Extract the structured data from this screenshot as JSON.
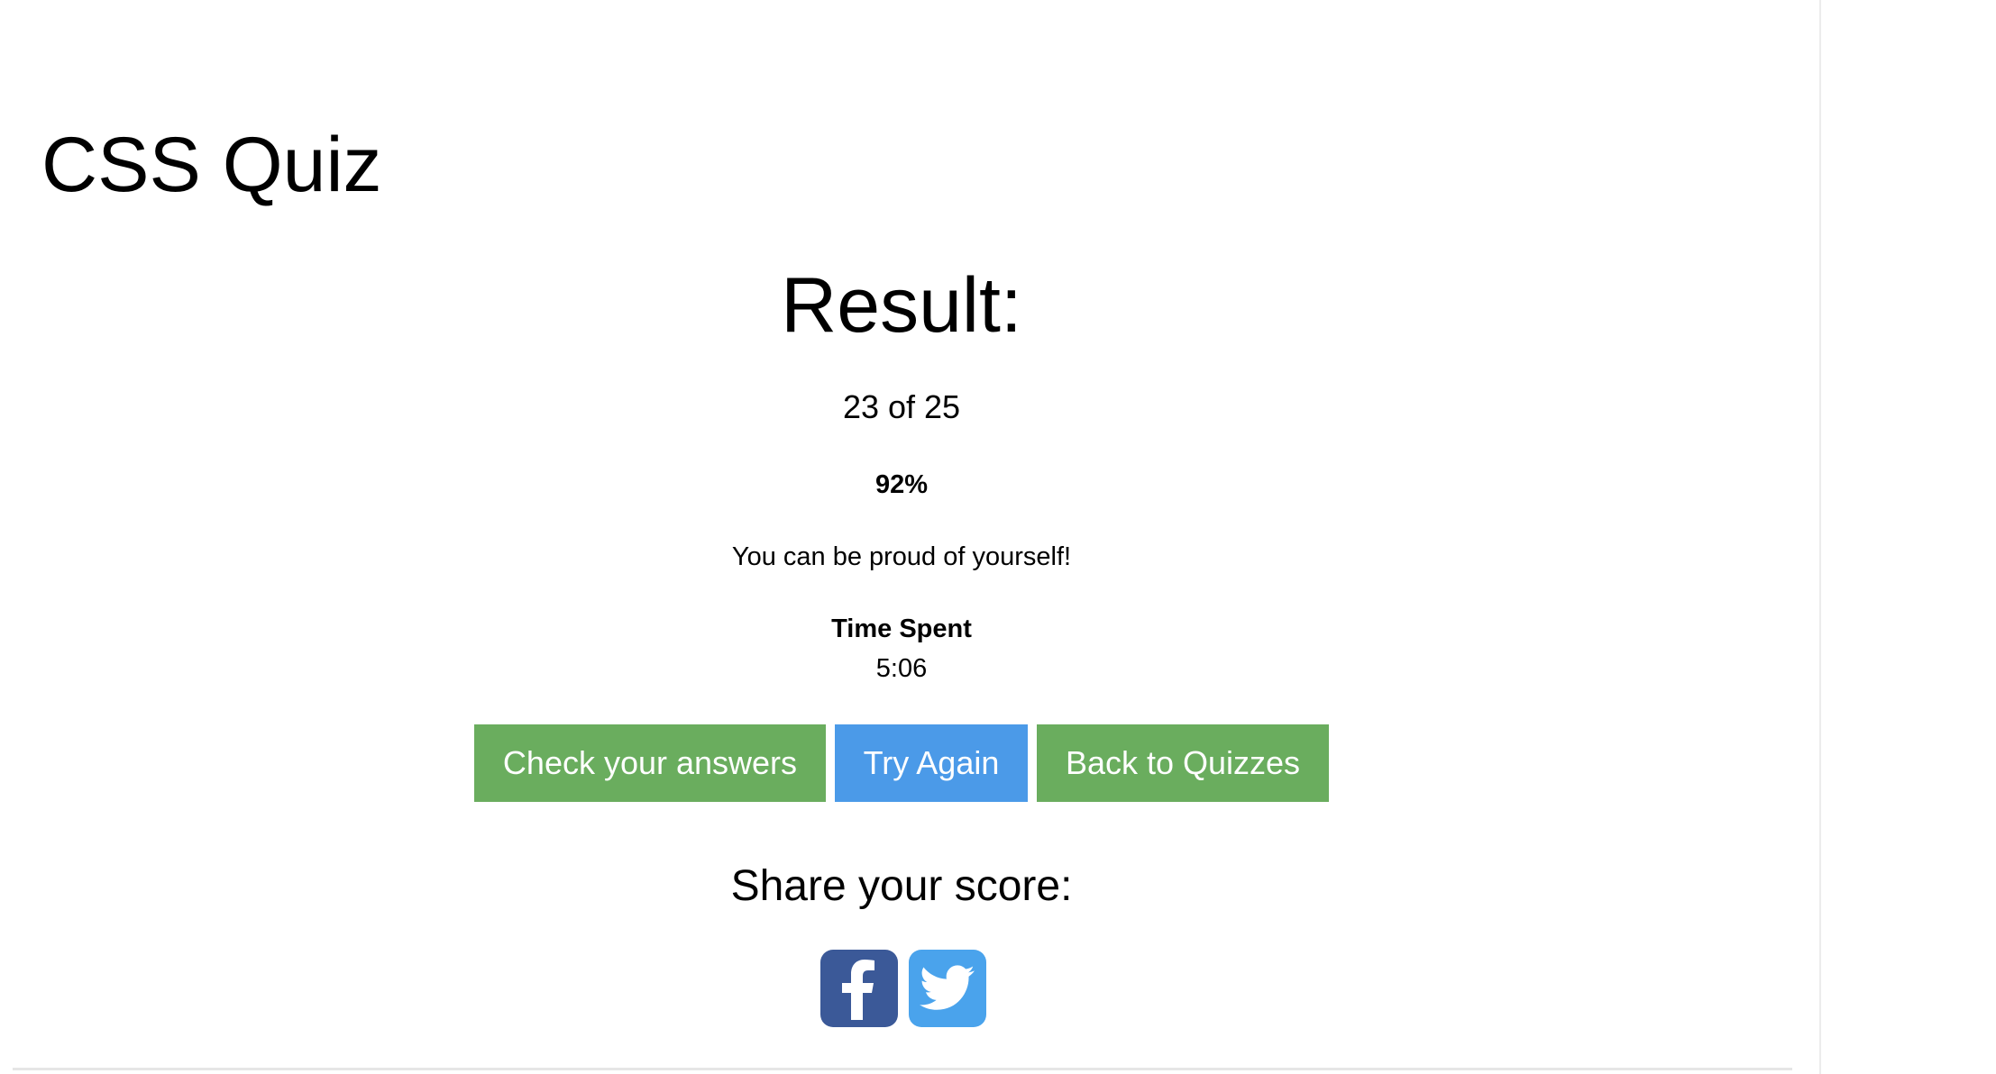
{
  "page": {
    "title": "CSS Quiz"
  },
  "result": {
    "heading": "Result:",
    "score_text": "23 of 25",
    "percent_text": "92%",
    "message": "You can be proud of yourself!",
    "time_label": "Time Spent",
    "time_value": "5:06"
  },
  "actions": {
    "check_label": "Check your answers",
    "try_again_label": "Try Again",
    "back_label": "Back to Quizzes"
  },
  "share": {
    "heading": "Share your score:",
    "icons": [
      "facebook-icon",
      "twitter-icon"
    ]
  },
  "colors": {
    "green_button": "#6aad5e",
    "blue_button": "#4b9ae8",
    "facebook": "#3b5998",
    "twitter": "#4aa3ec"
  }
}
